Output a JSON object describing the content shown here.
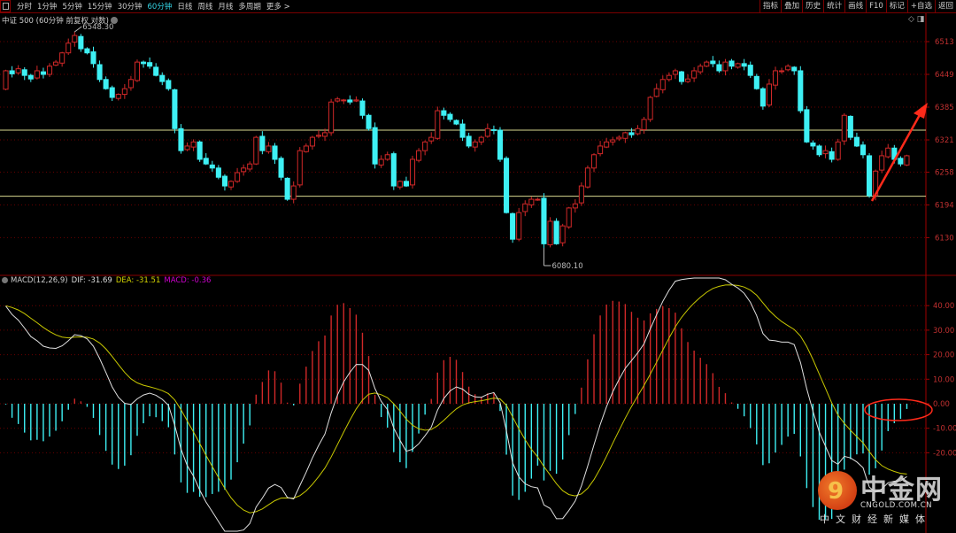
{
  "toolbar": {
    "tabs": [
      "分时",
      "1分钟",
      "5分钟",
      "15分钟",
      "30分钟",
      "60分钟",
      "日线",
      "周线",
      "月线",
      "多周期",
      "更多 >"
    ],
    "active_tab": "60分钟",
    "right_buttons": [
      "指标",
      "叠加",
      "历史",
      "统计",
      "画线",
      "F10",
      "标记",
      "+自选",
      "返回"
    ]
  },
  "title": "中证 500 (60分钟 前复权 对数)",
  "macd_legend": {
    "name": "MACD(12,26,9)",
    "dif": "DIF: -31.69",
    "dea": "DEA: -31.51",
    "macd": "MACD: -0.36"
  },
  "colors": {
    "up": "#d02828",
    "down": "#3ef0f4",
    "dif": "#e0e0e0",
    "dea": "#c8c800",
    "axis": "#c03030",
    "hline": "#d8d890",
    "annotation": "#ff2a1a"
  },
  "watermark": {
    "name": "中金网",
    "url": "CNGOLD.COM.CN",
    "slogan": "中文财经新媒体"
  },
  "chart_data": [
    {
      "type": "candlestick",
      "title": "中证 500 (60分钟 前复权 对数)",
      "y_ticks": [
        "6513",
        "6449",
        "6385",
        "6321",
        "6258",
        "6194",
        "6130"
      ],
      "y_tick_values": [
        6513,
        6449,
        6385,
        6321,
        6258,
        6194,
        6130
      ],
      "ylim": [
        6080,
        6570
      ],
      "high_label": "6548.30",
      "low_label": "6080.10",
      "support_resistance_lines": [
        6340,
        6211
      ],
      "closes": [
        6456,
        6450,
        6460,
        6447,
        6440,
        6456,
        6449,
        6465,
        6473,
        6491,
        6510,
        6525,
        6499,
        6491,
        6470,
        6439,
        6421,
        6404,
        6410,
        6421,
        6439,
        6473,
        6470,
        6465,
        6447,
        6435,
        6421,
        6343,
        6300,
        6309,
        6317,
        6283,
        6274,
        6266,
        6248,
        6231,
        6240,
        6257,
        6266,
        6274,
        6326,
        6300,
        6309,
        6283,
        6248,
        6205,
        6231,
        6300,
        6309,
        6326,
        6330,
        6335,
        6395,
        6401,
        6399,
        6395,
        6399,
        6369,
        6343,
        6274,
        6283,
        6292,
        6231,
        6240,
        6231,
        6283,
        6300,
        6317,
        6326,
        6378,
        6369,
        6361,
        6352,
        6326,
        6309,
        6317,
        6326,
        6343,
        6340,
        6283,
        6179,
        6127,
        6179,
        6196,
        6205,
        6205,
        6118,
        6162,
        6118,
        6153,
        6188,
        6196,
        6231,
        6266,
        6292,
        6309,
        6317,
        6321,
        6326,
        6335,
        6331,
        6343,
        6361,
        6404,
        6421,
        6439,
        6447,
        6456,
        6435,
        6440,
        6456,
        6465,
        6473,
        6470,
        6456,
        6473,
        6465,
        6470,
        6465,
        6447,
        6421,
        6387,
        6430,
        6456,
        6456,
        6465,
        6456,
        6378,
        6317,
        6309,
        6292,
        6300,
        6283,
        6317,
        6369,
        6326,
        6309,
        6292,
        6212,
        6260,
        6290,
        6305,
        6283,
        6274,
        6290
      ],
      "first_open": 6420
    },
    {
      "type": "macd",
      "params": [
        12,
        26,
        9
      ],
      "y_ticks": [
        "40.00",
        "30.00",
        "20.00",
        "10.00",
        "0.00",
        "-10.00",
        "-20.00"
      ],
      "y_tick_values": [
        40,
        30,
        20,
        10,
        0,
        -10,
        -20
      ],
      "initial_dif": 43,
      "initial_dea": 40,
      "current": {
        "dif": -31.69,
        "dea": -31.51,
        "macd": -0.36
      }
    }
  ]
}
